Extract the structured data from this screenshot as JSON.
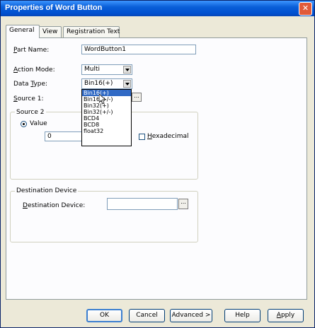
{
  "window": {
    "title": "Properties of Word Button"
  },
  "tabs": [
    {
      "label": "General"
    },
    {
      "label": "View"
    },
    {
      "label": "Registration Text"
    }
  ],
  "part_name": {
    "label_u": "P",
    "label_rest": "art Name:",
    "value": "WordButton1"
  },
  "action_mode": {
    "label_u": "A",
    "label_rest": "ction Mode:",
    "value": "Multi"
  },
  "data_type": {
    "label_pre": "Data ",
    "label_u": "T",
    "label_rest": "ype:",
    "value": "Bin16(+)",
    "options": [
      "Bin16(+)",
      "Bin16(+/-)",
      "Bin32(+)",
      "Bin32(+/-)",
      "BCD4",
      "BCD8",
      "float32"
    ]
  },
  "source1": {
    "label_u": "S",
    "label_rest": "ource 1:",
    "browse": "..."
  },
  "source2": {
    "title": "Source 2",
    "value_label": "Value",
    "value": "0",
    "hex_label_u": "H",
    "hex_label_rest": "exadecimal"
  },
  "destination": {
    "group_title": "Destination Device",
    "label_u": "D",
    "label_rest": "estination Device:",
    "value": "",
    "browse": "..."
  },
  "buttons": {
    "ok": "OK",
    "cancel": "Cancel",
    "advanced": "Advanced >",
    "help": "Help",
    "apply_u": "A",
    "apply_rest": "pply"
  }
}
